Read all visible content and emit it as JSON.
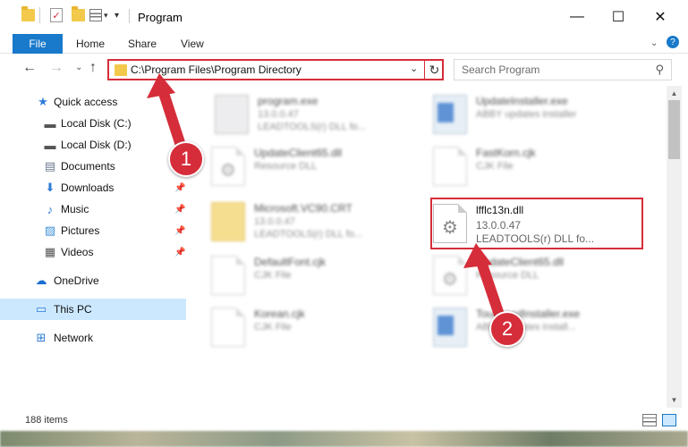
{
  "window": {
    "title": "Program",
    "minimize": "—",
    "maximize": "☐",
    "close": "✕"
  },
  "ribbon": {
    "file": "File",
    "tabs": [
      "Home",
      "Share",
      "View"
    ],
    "help_icon": "?"
  },
  "address_bar": {
    "path": "C:\\Program Files\\Program Directory",
    "back": "←",
    "forward": "→",
    "recent": "⌄",
    "up": "↑",
    "dropdown": "⌄",
    "refresh": "↻"
  },
  "search": {
    "placeholder": "Search Program",
    "icon": "⚲"
  },
  "sidebar": {
    "items": [
      {
        "label": "Quick access",
        "icon": "★"
      },
      {
        "label": "Local Disk (C:)",
        "icon": "▬"
      },
      {
        "label": "Local Disk (D:)",
        "icon": "▬"
      },
      {
        "label": "Documents",
        "icon": "▤"
      },
      {
        "label": "Downloads",
        "icon": "⬇"
      },
      {
        "label": "Music",
        "icon": "♪"
      },
      {
        "label": "Pictures",
        "icon": "▨"
      },
      {
        "label": "Videos",
        "icon": "▦"
      },
      {
        "label": "OneDrive",
        "icon": "☁"
      },
      {
        "label": "This PC",
        "icon": "▭"
      },
      {
        "label": "Network",
        "icon": "⊞"
      }
    ],
    "pin": "📌"
  },
  "files": [
    {
      "name": "program.exe",
      "line2": "13.0.0.47",
      "line3": "LEADTOOLS(r) DLL fo..."
    },
    {
      "name": "UpdateInstaller.exe",
      "line2": "ABBY updates installer",
      "line3": ""
    },
    {
      "name": "UpdateClient65.dll",
      "line2": "Resource DLL",
      "line3": ""
    },
    {
      "name": "FastKorn.cjk",
      "line2": "CJK File",
      "line3": ""
    },
    {
      "name": "Microsoft.VC90.CRT",
      "line2": "13.0.0.47",
      "line3": "LEADTOOLS(r) DLL fo..."
    },
    {
      "name": "lfflc13n.dll",
      "line2": "13.0.0.47",
      "line3": "LEADTOOLS(r) DLL fo..."
    },
    {
      "name": "DefaultFont.cjk",
      "line2": "CJK File",
      "line3": ""
    },
    {
      "name": "UpdateClient65.dll",
      "line2": "Resource DLL",
      "line3": ""
    },
    {
      "name": "Korean.cjk",
      "line2": "CJK File",
      "line3": ""
    },
    {
      "name": "TouchpadInstaller.exe",
      "line2": "ABBY updates install...",
      "line3": ""
    }
  ],
  "status": {
    "count": "188 items"
  },
  "annotations": {
    "step1": "1",
    "step2": "2"
  },
  "colors": {
    "accent": "#1979ca",
    "highlight": "#d62d3a",
    "selection": "#cce8ff"
  }
}
